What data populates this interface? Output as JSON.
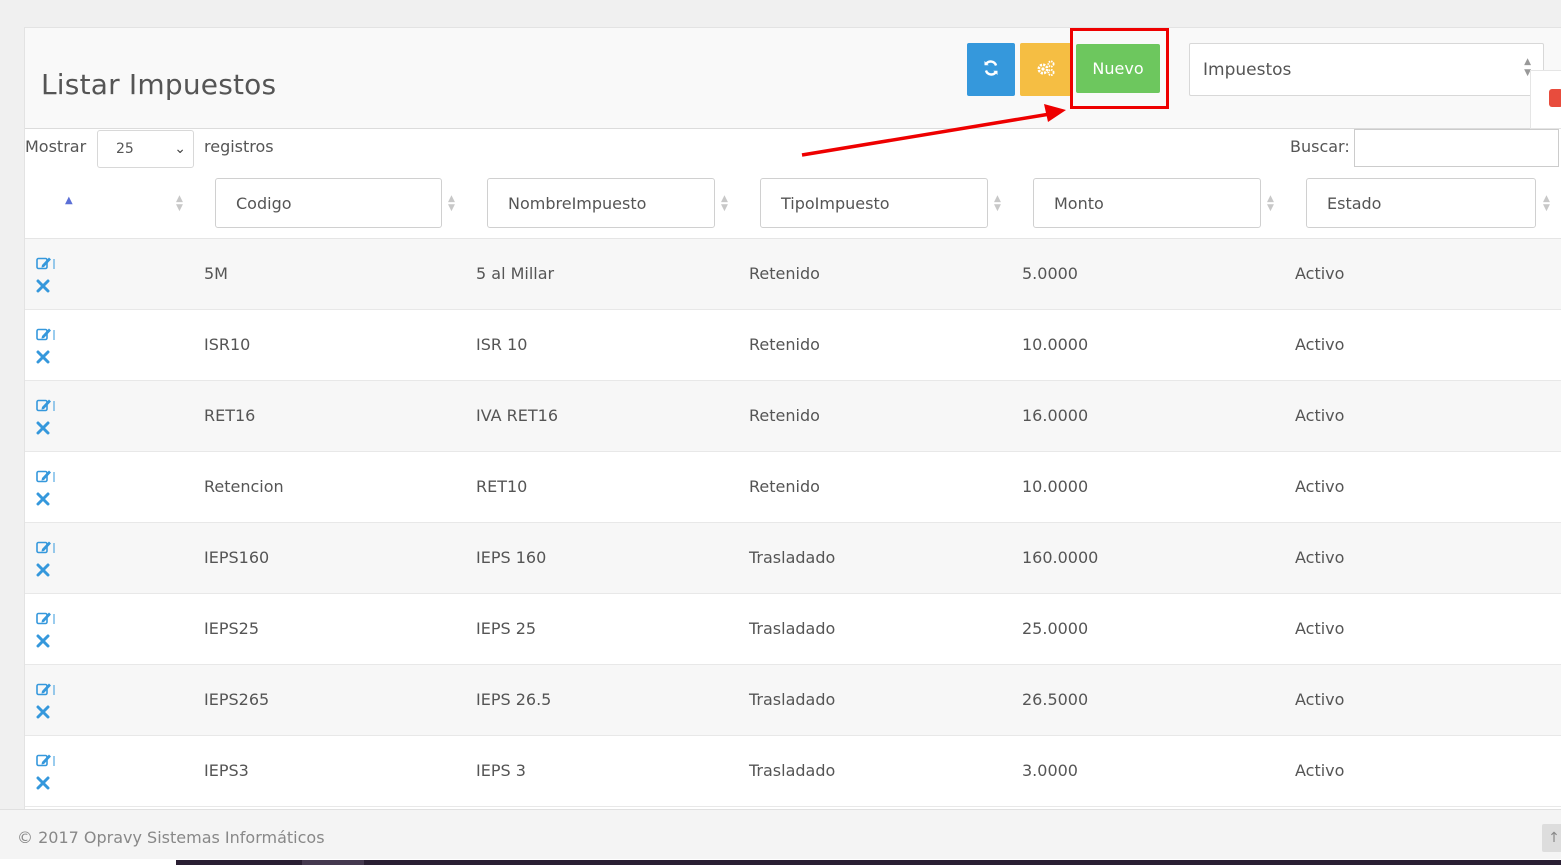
{
  "header": {
    "title": "Listar Impuestos",
    "new_button_label": "Nuevo",
    "refresh_icon": "refresh-icon",
    "config_icon": "cogs-icon",
    "module_select_value": "Impuestos"
  },
  "controls": {
    "show_label": "Mostrar",
    "page_length": "25",
    "records_label": "registros",
    "search_label": "Buscar:",
    "search_value": ""
  },
  "table": {
    "columns": [
      "Codigo",
      "NombreImpuesto",
      "TipoImpuesto",
      "Monto",
      "Estado"
    ],
    "rows": [
      {
        "codigo": "5M",
        "nombre": "5 al Millar",
        "tipo": "Retenido",
        "monto": "5.0000",
        "estado": "Activo"
      },
      {
        "codigo": "ISR10",
        "nombre": "ISR 10",
        "tipo": "Retenido",
        "monto": "10.0000",
        "estado": "Activo"
      },
      {
        "codigo": "RET16",
        "nombre": "IVA RET16",
        "tipo": "Retenido",
        "monto": "16.0000",
        "estado": "Activo"
      },
      {
        "codigo": "Retencion",
        "nombre": "RET10",
        "tipo": "Retenido",
        "monto": "10.0000",
        "estado": "Activo"
      },
      {
        "codigo": "IEPS160",
        "nombre": "IEPS 160",
        "tipo": "Trasladado",
        "monto": "160.0000",
        "estado": "Activo"
      },
      {
        "codigo": "IEPS25",
        "nombre": "IEPS 25",
        "tipo": "Trasladado",
        "monto": "25.0000",
        "estado": "Activo"
      },
      {
        "codigo": "IEPS265",
        "nombre": "IEPS 26.5",
        "tipo": "Trasladado",
        "monto": "26.5000",
        "estado": "Activo"
      },
      {
        "codigo": "IEPS3",
        "nombre": "IEPS 3",
        "tipo": "Trasladado",
        "monto": "3.0000",
        "estado": "Activo"
      }
    ]
  },
  "footer": {
    "copyright": "© 2017 Opravy Sistemas Informáticos"
  },
  "colors": {
    "refresh_button": "#3598dc",
    "config_button": "#f5be43",
    "new_button": "#6dc75e",
    "annotation": "#ee0000",
    "action_icon": "#3598dc"
  }
}
